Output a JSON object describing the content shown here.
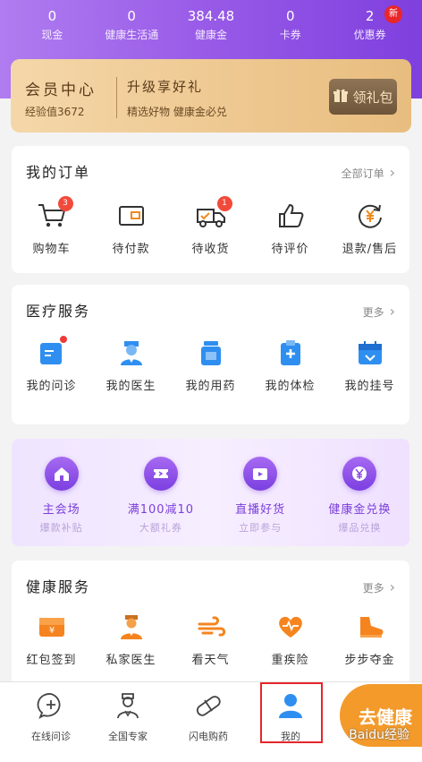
{
  "stats": [
    {
      "value": "0",
      "label": "现金"
    },
    {
      "value": "0",
      "label": "健康生活通"
    },
    {
      "value": "384.48",
      "label": "健康金"
    },
    {
      "value": "0",
      "label": "卡券"
    },
    {
      "value": "2",
      "label": "优惠券",
      "badge": "新"
    }
  ],
  "vip": {
    "title": "会员中心",
    "exp": "经验值3672",
    "upgrade_title": "升级享好礼",
    "upgrade_desc": "精选好物  健康金必兑",
    "gift_label": "领礼包"
  },
  "orders": {
    "title": "我的订单",
    "more": "全部订单",
    "items": [
      {
        "label": "购物车",
        "icon": "cart-icon",
        "badge": "3"
      },
      {
        "label": "待付款",
        "icon": "wallet-icon"
      },
      {
        "label": "待收货",
        "icon": "truck-icon",
        "badge": "1"
      },
      {
        "label": "待评价",
        "icon": "thumbs-up-icon"
      },
      {
        "label": "退款/售后",
        "icon": "refund-icon"
      }
    ]
  },
  "medical": {
    "title": "医疗服务",
    "more": "更多",
    "items": [
      {
        "label": "我的问诊",
        "icon": "consult-icon"
      },
      {
        "label": "我的医生",
        "icon": "doctor-icon"
      },
      {
        "label": "我的用药",
        "icon": "medicine-icon"
      },
      {
        "label": "我的体检",
        "icon": "checkup-icon"
      },
      {
        "label": "我的挂号",
        "icon": "calendar-icon"
      }
    ]
  },
  "promo": {
    "items": [
      {
        "label": "主会场",
        "sub": "爆款补贴",
        "icon": "home-icon"
      },
      {
        "label": "满100减10",
        "sub": "大额礼券",
        "icon": "ticket-icon"
      },
      {
        "label": "直播好货",
        "sub": "立即参与",
        "icon": "live-play-icon"
      },
      {
        "label": "健康金兑换",
        "sub": "爆品兑换",
        "icon": "yen-coin-icon"
      }
    ]
  },
  "health": {
    "title": "健康服务",
    "more": "更多",
    "items": [
      {
        "label": "红包签到",
        "icon": "red-envelope-icon"
      },
      {
        "label": "私家医生",
        "icon": "private-doctor-icon"
      },
      {
        "label": "看天气",
        "icon": "weather-icon"
      },
      {
        "label": "重疾险",
        "icon": "heart-insurance-icon"
      },
      {
        "label": "步步夺金",
        "icon": "shoe-icon"
      }
    ]
  },
  "tabbar": {
    "items": [
      {
        "label": "在线问诊",
        "icon": "chat-plus-icon"
      },
      {
        "label": "全国专家",
        "icon": "expert-icon"
      },
      {
        "label": "闪电购药",
        "icon": "pill-icon"
      },
      {
        "label": "我的",
        "icon": "user-icon"
      }
    ],
    "cta": "去健康"
  },
  "watermark": "Baidu经验",
  "colors": {
    "purple": "#8a4be4",
    "gold": "#eec891",
    "orange": "#f39a2a",
    "blue": "#2f8ff0"
  }
}
